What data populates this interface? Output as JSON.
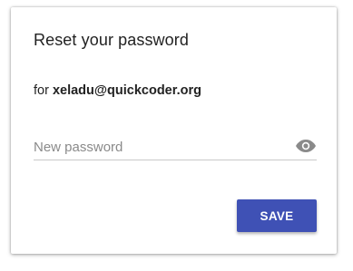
{
  "dialog": {
    "title": "Reset your password",
    "for_prefix": "for ",
    "email": "xeladu@quickcoder.org",
    "password_field": {
      "placeholder": "New password",
      "value": "",
      "visibility_icon": "eye-icon",
      "icon_color": "#8a8a8a"
    },
    "save_label": "SAVE",
    "accent_color": "#3f51b5"
  }
}
